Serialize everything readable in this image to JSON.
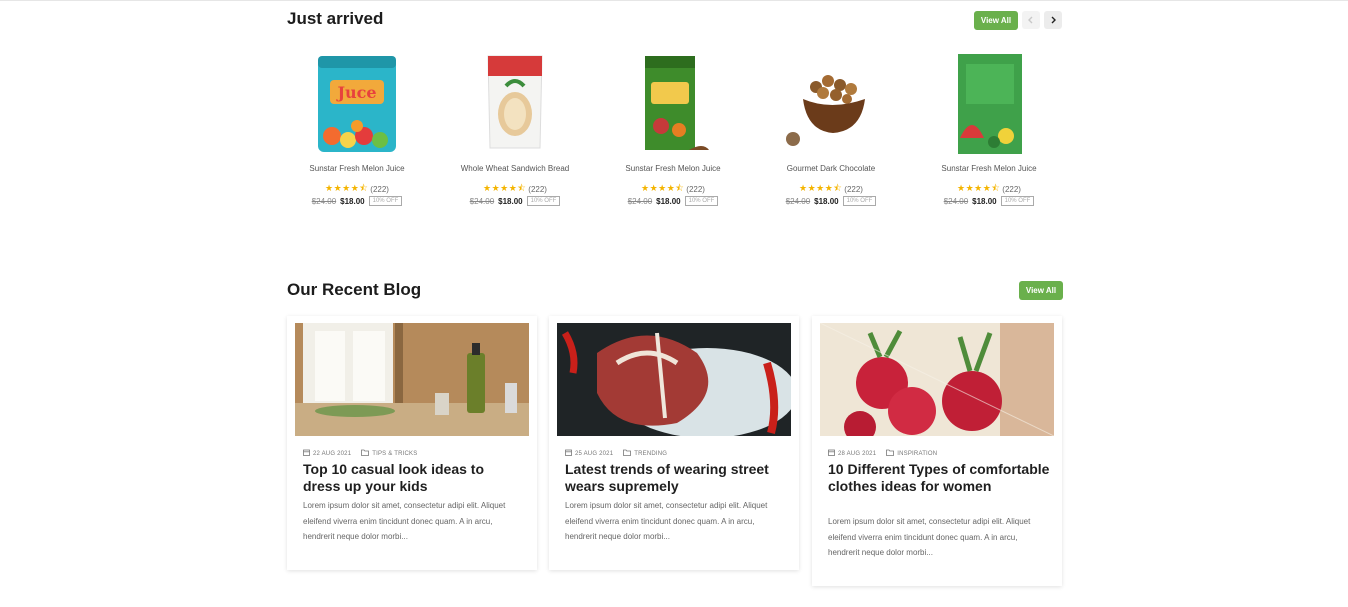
{
  "just_arrived": {
    "title": "Just arrived",
    "view_all": "View All",
    "prev_icon": "chevron-left-icon",
    "next_icon": "chevron-right-icon",
    "products": [
      {
        "name": "Sunstar Fresh Melon Juice",
        "rating": 4.5,
        "reviews": "(222)",
        "old_price": "$24.00",
        "price": "$18.00",
        "discount": "10% OFF",
        "image": "juice-pack"
      },
      {
        "name": "Whole Wheat Sandwich Bread",
        "rating": 4.5,
        "reviews": "(222)",
        "old_price": "$24.00",
        "price": "$18.00",
        "discount": "10% OFF",
        "image": "bread-bag"
      },
      {
        "name": "Sunstar Fresh Melon Juice",
        "rating": 4.5,
        "reviews": "(222)",
        "old_price": "$24.00",
        "price": "$18.00",
        "discount": "10% OFF",
        "image": "snack-sachet"
      },
      {
        "name": "Gourmet Dark Chocolate",
        "rating": 4.5,
        "reviews": "(222)",
        "old_price": "$24.00",
        "price": "$18.00",
        "discount": "10% OFF",
        "image": "chocolate-bowl"
      },
      {
        "name": "Sunstar Fresh Melon Juice",
        "rating": 4.5,
        "reviews": "(222)",
        "old_price": "$24.00",
        "price": "$18.00",
        "discount": "10% OFF",
        "image": "green-pouch"
      }
    ]
  },
  "recent_blog": {
    "title": "Our Recent Blog",
    "view_all": "View All",
    "posts": [
      {
        "date": "22 AUG 2021",
        "category": "TIPS & TRICKS",
        "title": "Top 10 casual look ideas to dress up your kids",
        "excerpt": "Lorem ipsum dolor sit amet, consectetur adipi elit. Aliquet eleifend viverra enim tincidunt donec quam. A in arcu, hendrerit neque dolor morbi...",
        "image": "kitchen-table"
      },
      {
        "date": "25 AUG 2021",
        "category": "TRENDING",
        "title": "Latest trends of wearing street wears supremely",
        "excerpt": "Lorem ipsum dolor sit amet, consectetur adipi elit. Aliquet eleifend viverra enim tincidunt donec quam. A in arcu, hendrerit neque dolor morbi...",
        "image": "steak-on-ice"
      },
      {
        "date": "28 AUG 2021",
        "category": "INSPIRATION",
        "title": "10 Different Types of comfortable clothes ideas for women",
        "excerpt": "Lorem ipsum dolor sit amet, consectetur adipi elit. Aliquet eleifend viverra enim tincidunt donec quam. A in arcu, hendrerit neque dolor morbi...",
        "image": "radishes-in-bag"
      }
    ]
  },
  "colors": {
    "accent": "#6ab04c",
    "star": "#f4b400"
  }
}
